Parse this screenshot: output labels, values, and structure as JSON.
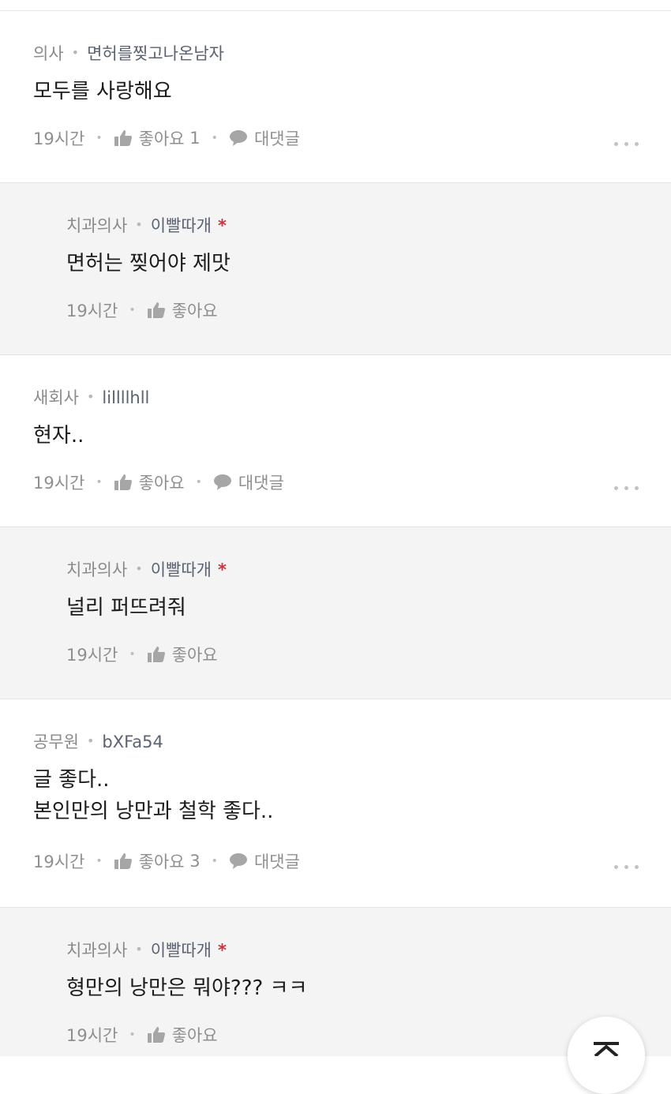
{
  "comments": [
    {
      "job": "의사",
      "nick": "면허를찢고나온남자",
      "body": "모두를 사랑해요",
      "time": "19시간",
      "like_label": "좋아요",
      "like_count": "1",
      "reply_label": "대댓글"
    },
    {
      "job": "치과의사",
      "nick": "이빨따개",
      "star": "*",
      "body": "면허는 찢어야 제맛",
      "time": "19시간",
      "like_label": "좋아요"
    },
    {
      "job": "새회사",
      "nick": "lillllhll",
      "body": "현자..",
      "time": "19시간",
      "like_label": "좋아요",
      "reply_label": "대댓글"
    },
    {
      "job": "치과의사",
      "nick": "이빨따개",
      "star": "*",
      "body": "널리 퍼뜨려줘",
      "time": "19시간",
      "like_label": "좋아요"
    },
    {
      "job": "공무원",
      "nick": "bXFa54",
      "body": "글 좋다..\n본인만의 낭만과 철학 좋다..",
      "time": "19시간",
      "like_label": "좋아요",
      "like_count": "3",
      "reply_label": "대댓글"
    },
    {
      "job": "치과의사",
      "nick": "이빨따개",
      "star": "*",
      "body": "형만의 낭만은 뭐야??? ㅋㅋ",
      "time": "19시간",
      "like_label": "좋아요"
    }
  ],
  "colors": {
    "reply_bg": "#f4f4f5",
    "author_star": "#d0303a",
    "meta_text": "#8a8a8a"
  },
  "icons": {
    "like": "thumbs-up-icon",
    "reply": "speech-bubble-icon",
    "more": "more-dots-icon",
    "top": "scroll-to-top-icon"
  }
}
